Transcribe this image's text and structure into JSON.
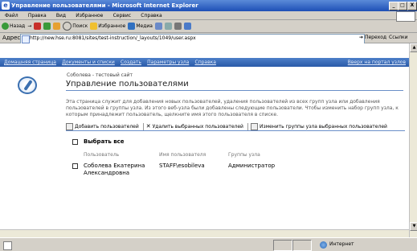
{
  "window": {
    "title": "Управление пользователями - Microsoft Internet Explorer",
    "min_label": "_",
    "max_label": "□",
    "close_label": "X"
  },
  "menu": [
    "Файл",
    "Правка",
    "Вид",
    "Избранное",
    "Сервис",
    "Справка"
  ],
  "toolbar": {
    "back": "Назад",
    "forward": "→",
    "search": "Поиск",
    "favorites": "Избранное",
    "media": "Медиа"
  },
  "address": {
    "label": "Адрес",
    "url": "http://new.hse.ru:8081/sites/test-instruction/_layouts/1049/user.aspx",
    "go": "Переход",
    "links": "Ссылки"
  },
  "sitenav": {
    "items": [
      "Домашняя страница",
      "Документы и списки",
      "Создать",
      "Параметры узла",
      "Справка"
    ],
    "portal_link": "Вверх на портал узлов"
  },
  "page": {
    "breadcrumb": "Соболева - тестовый сайт",
    "title": "Управление пользователями",
    "description": "Эта страница служит для добавления новых пользователей, удаления пользователей из всех групп узла или добавления пользователей в группы узла. Из этого веб-узла были добавлены следующие пользователи. Чтобы изменить набор групп узла, к которым принадлежит пользователь, щелкните имя этого пользователя в списке."
  },
  "actions": {
    "add": "Добавить пользователей",
    "remove": "Удалить выбранных пользователей",
    "change": "Изменить группы узла выбранных пользователей"
  },
  "table": {
    "select_all": "Выбрать все",
    "headers": [
      "Пользователь",
      "Имя пользователя",
      "Группы узла"
    ],
    "rows": [
      {
        "user": "Соболева Екатерина Александровна",
        "username": "STAFF\\esobileva",
        "group": "Администратор"
      }
    ]
  },
  "status": {
    "zone": "Интернет"
  }
}
